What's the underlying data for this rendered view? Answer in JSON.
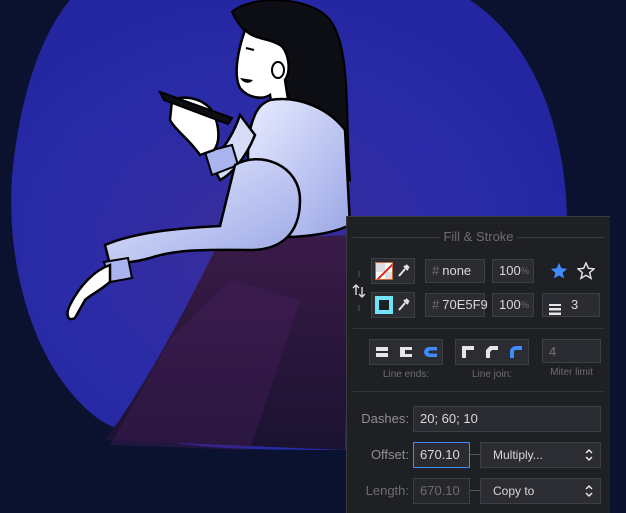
{
  "panel": {
    "title": "Fill & Stroke",
    "fill": {
      "hex": "none",
      "opacity": "100",
      "pct_unit": "%"
    },
    "stroke": {
      "hex": "70E5F9",
      "opacity": "100",
      "pct_unit": "%",
      "width": "3"
    },
    "hash_symbol": "#",
    "line_ends_label": "Line ends:",
    "line_join_label": "Line join:",
    "miter": {
      "placeholder": "4",
      "label": "Miter limit"
    },
    "dashes": {
      "label": "Dashes:",
      "value": "20; 60; 10"
    },
    "offset": {
      "label": "Offset:",
      "value": "670.10",
      "blend": "Multiply..."
    },
    "length": {
      "label": "Length:",
      "value": "670.10",
      "mode": "Copy to"
    }
  },
  "colors": {
    "accent": "#3f8cff",
    "stroke_color": "#70E5F9",
    "panel_bg": "#1f2024"
  }
}
